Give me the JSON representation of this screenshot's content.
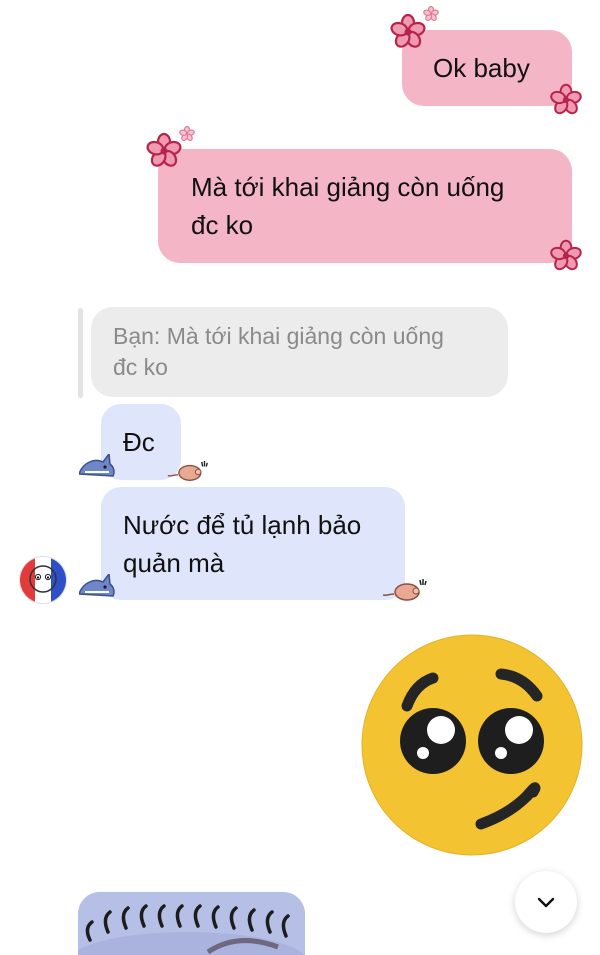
{
  "messages": {
    "sent_1": "Ok baby",
    "sent_2_line1": "Mà tới khai giảng còn uống",
    "sent_2_line2": "đc ko",
    "reply_quote_line1": "Bạn: Mà tới khai giảng còn uống",
    "reply_quote_line2": "đc ko",
    "recv_1": "Đc",
    "recv_2_line1": "Nước để tủ lạnh bảo",
    "recv_2_line2": "quản mà"
  },
  "icons": {
    "flower": "flower-sticker-icon",
    "shark": "shark-sticker-icon",
    "pig": "pig-sticker-icon",
    "emoji": "pleading-face-emoji",
    "scroll": "chevron-down-icon"
  },
  "colors": {
    "sent_bubble": "#f4b5c7",
    "recv_bubble": "#dfe6fb",
    "reply_bubble": "#ececec",
    "emoji_face": "#f3c332"
  }
}
